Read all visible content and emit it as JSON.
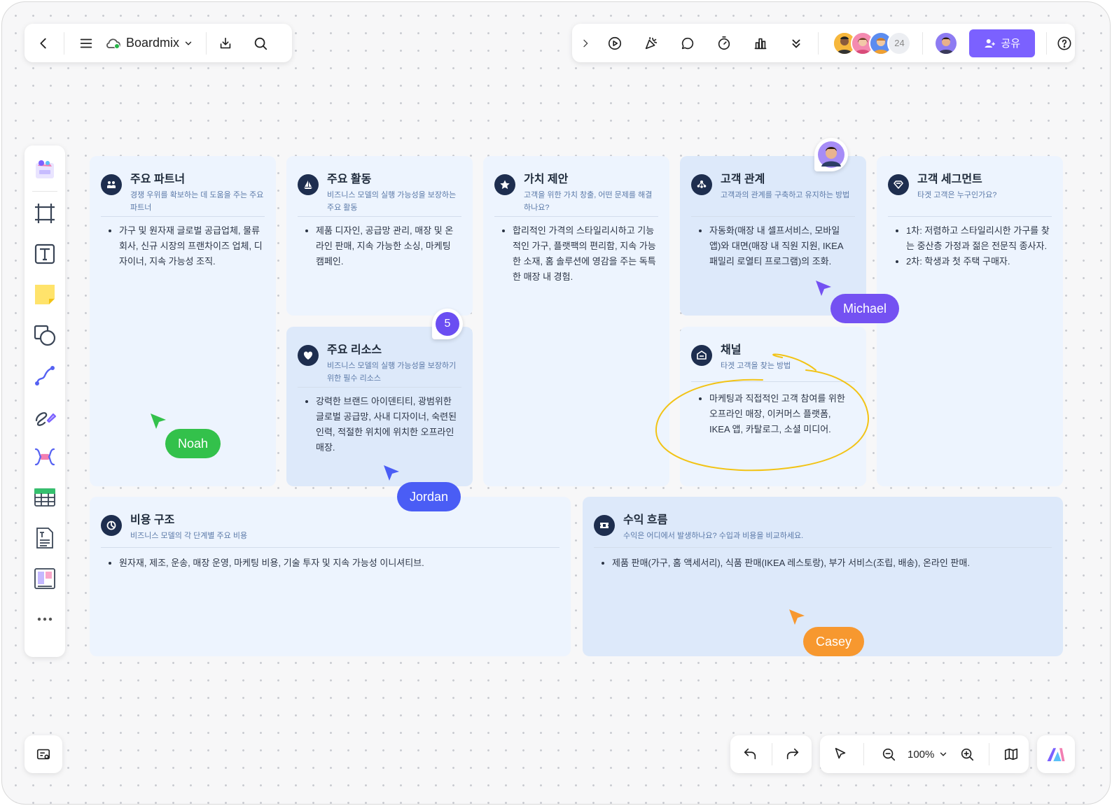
{
  "app": {
    "workspace_name": "Boardmix",
    "share_label": "공유",
    "collaborator_count": "24",
    "zoom": "100%"
  },
  "colors": {
    "accent": "#7b61ff",
    "card_light": "#edf4fe",
    "card_dark": "#dde9fa",
    "icon_bg": "#1e2e4f",
    "noah": "#33c14b",
    "jordan": "#4a5df5",
    "michael": "#7451f2",
    "casey": "#f7982f",
    "highlight": "#f2c315"
  },
  "cards": {
    "partners": {
      "title": "주요 파트너",
      "subtitle": "경쟁 우위를 확보하는 데 도움을 주는 주요 파트너",
      "icon": "people-icon",
      "items": [
        "가구 및 원자재 글로벌 공급업체, 물류 회사, 신규 시장의 프랜차이즈 업체, 디자이너, 지속 가능성 조직."
      ]
    },
    "activities": {
      "title": "주요 활동",
      "subtitle": "비즈니스 모델의 실행 가능성을 보장하는 주요 활동",
      "icon": "sailboat-icon",
      "items": [
        "제품 디자인, 공급망 관리, 매장 및 온라인 판매, 지속 가능한 소싱, 마케팅 캠페인."
      ]
    },
    "value": {
      "title": "가치 제안",
      "subtitle": "고객을 위한 가치 창출, 어떤 문제를 해결하나요?",
      "icon": "star-icon",
      "items": [
        "합리적인 가격의 스타일리시하고 기능적인 가구, 플랫팩의 편리함, 지속 가능한 소재, 홈 솔루션에 영감을 주는 독특한 매장 내 경험."
      ]
    },
    "relations": {
      "title": "고객 관계",
      "subtitle": "고객과의 관계를 구축하고 유지하는 방법",
      "icon": "network-icon",
      "items": [
        "자동화(매장 내 셀프서비스, 모바일 앱)와 대면(매장 내 직원 지원, IKEA 패밀리 로열티 프로그램)의 조화."
      ]
    },
    "segments": {
      "title": "고객 세그먼트",
      "subtitle": "타겟 고객은 누구인가요?",
      "icon": "diamond-icon",
      "items": [
        "1차: 저렴하고 스타일리시한 가구를 찾는 중산층 가정과 젊은 전문직 종사자.",
        "2차: 학생과 첫 주택 구매자."
      ]
    },
    "resources": {
      "title": "주요 리소스",
      "subtitle": "비즈니스 모델의 실행 가능성을 보장하기 위한 필수 리소스",
      "icon": "heart-icon",
      "items": [
        "강력한 브랜드 아이덴티티, 광범위한 글로벌 공급망, 사내 디자이너, 숙련된 인력, 적절한 위치에 위치한 오프라인 매장."
      ]
    },
    "channels": {
      "title": "채널",
      "subtitle": "타겟 고객을 찾는 방법",
      "icon": "mailbox-icon",
      "items": [
        "마케팅과 직접적인 고객 참여를 위한 오프라인 매장, 이커머스 플랫폼, IKEA 앱, 카탈로그, 소셜 미디어."
      ]
    },
    "cost": {
      "title": "비용 구조",
      "subtitle": "비즈니스 모델의 각 단계별 주요 비용",
      "icon": "pie-icon",
      "items": [
        "원자재, 제조, 운송, 매장 운영, 마케팅 비용, 기술 투자 및 지속 가능성 이니셔티브."
      ]
    },
    "revenue": {
      "title": "수익 흐름",
      "subtitle": "수익은 어디에서 발생하나요? 수입과 비용을 비교하세요.",
      "icon": "ticket-icon",
      "items": [
        "제품 판매(가구, 홈 액세서리), 식품 판매(IKEA 레스토랑), 부가 서비스(조립, 배송), 온라인 판매."
      ]
    }
  },
  "comment_badge": "5",
  "cursors": {
    "noah": "Noah",
    "jordan": "Jordan",
    "michael": "Michael",
    "casey": "Casey"
  }
}
